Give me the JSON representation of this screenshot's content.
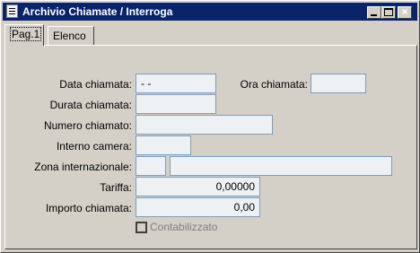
{
  "window": {
    "title": "Archivio Chiamate / Interroga"
  },
  "tabs": [
    {
      "label": "Pag.1"
    },
    {
      "label": "Elenco"
    }
  ],
  "form": {
    "data_chiamata": {
      "label": "Data chiamata:",
      "value": "- -"
    },
    "ora_chiamata": {
      "label": "Ora chiamata:",
      "value": ""
    },
    "durata_chiamata": {
      "label": "Durata chiamata:",
      "value": ""
    },
    "numero_chiamato": {
      "label": "Numero chiamato:",
      "value": ""
    },
    "interno_camera": {
      "label": "Interno camera:",
      "value": ""
    },
    "zona_internazionale": {
      "label": "Zona internazionale:",
      "code": "",
      "description": ""
    },
    "tariffa": {
      "label": "Tariffa:",
      "value": "0,00000"
    },
    "importo_chiamata": {
      "label": "Importo chiamata:",
      "value": "0,00"
    },
    "contabilizzato": {
      "label": "Contabilizzato",
      "checked": false
    }
  },
  "colors": {
    "titlebar": "#0a246a",
    "field_bg": "#eef1f4",
    "field_border": "#7f9db9"
  }
}
